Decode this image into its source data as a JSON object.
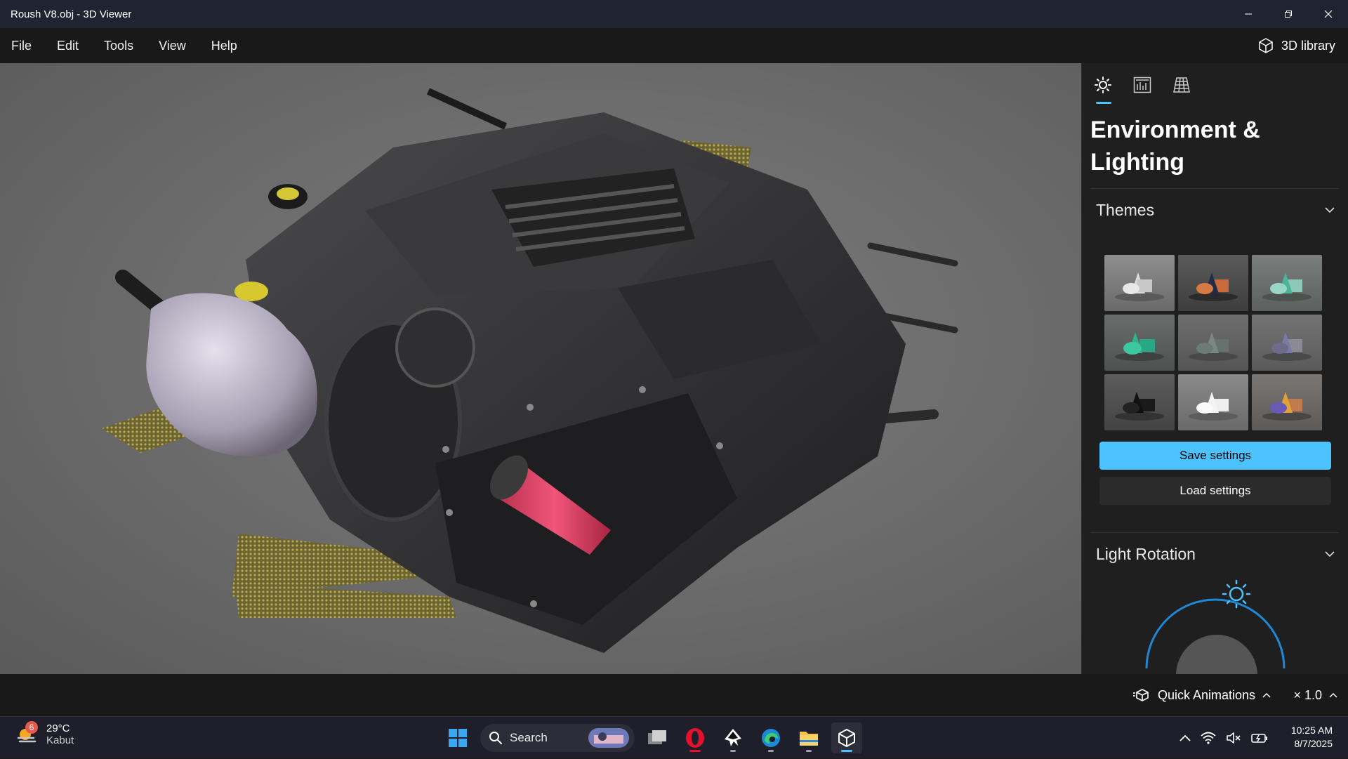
{
  "window": {
    "title": "Roush V8.obj - 3D Viewer"
  },
  "menu": {
    "items": [
      "File",
      "Edit",
      "Tools",
      "View",
      "Help"
    ],
    "library_label": "3D library"
  },
  "panel": {
    "tabs": [
      "sun-icon",
      "stats-icon",
      "grid-icon"
    ],
    "title": "Environment & Lighting",
    "themes_label": "Themes",
    "save_label": "Save settings",
    "load_label": "Load settings",
    "light_rotation_label": "Light Rotation"
  },
  "bottom": {
    "quick_animations_label": "Quick Animations",
    "speed_label": "× 1.0"
  },
  "taskbar": {
    "weather_badge": "6",
    "weather_temp": "29°C",
    "weather_condition": "Kabut",
    "search_placeholder": "Search",
    "time": "10:25 AM",
    "date": "8/7/2025"
  },
  "colors": {
    "accent": "#4cc2ff",
    "titlebar": "#202331",
    "panel": "#1f1f1f"
  }
}
